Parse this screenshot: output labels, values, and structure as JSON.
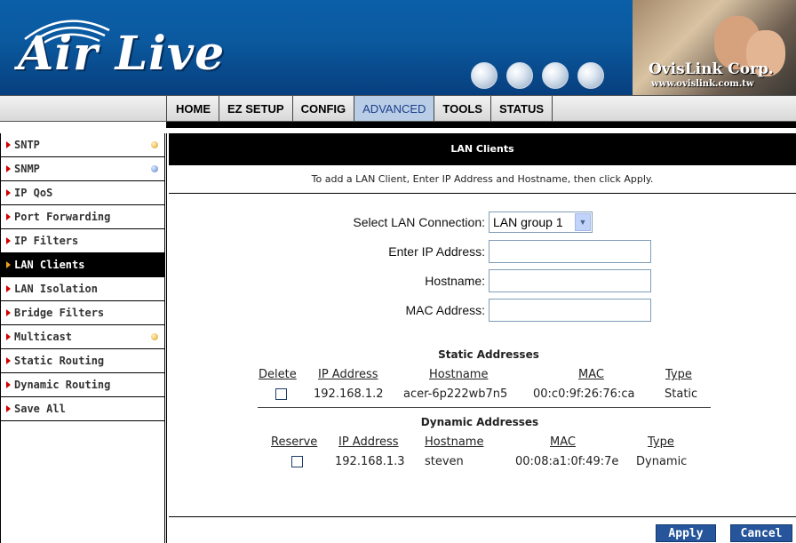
{
  "header": {
    "logo_text": "Air Live",
    "corp_name": "OvisLink Corp.",
    "corp_url": "www.ovislink.com.tw"
  },
  "nav": {
    "tabs": [
      {
        "label": "HOME",
        "active": false
      },
      {
        "label": "EZ SETUP",
        "active": false
      },
      {
        "label": "CONFIG",
        "active": false
      },
      {
        "label": "ADVANCED",
        "active": true
      },
      {
        "label": "TOOLS",
        "active": false
      },
      {
        "label": "STATUS",
        "active": false
      }
    ]
  },
  "sidebar": {
    "items": [
      {
        "label": "SNTP",
        "dot": "orange"
      },
      {
        "label": "SNMP",
        "dot": "blue"
      },
      {
        "label": "IP QoS"
      },
      {
        "label": "Port Forwarding"
      },
      {
        "label": "IP Filters"
      },
      {
        "label": "LAN Clients",
        "active": true
      },
      {
        "label": "LAN Isolation"
      },
      {
        "label": "Bridge Filters"
      },
      {
        "label": "Multicast",
        "dot": "orange"
      },
      {
        "label": "Static Routing"
      },
      {
        "label": "Dynamic Routing"
      },
      {
        "label": "Save All"
      }
    ]
  },
  "main": {
    "title": "LAN Clients",
    "instruction": "To add a LAN Client, Enter IP Address and Hostname, then click Apply.",
    "select_label": "Select LAN Connection:",
    "select_value": "LAN group 1",
    "ip_label": "Enter IP Address:",
    "ip_value": "",
    "hostname_label": "Hostname:",
    "hostname_value": "",
    "mac_label": "MAC Address:",
    "mac_value": "",
    "static": {
      "title": "Static Addresses",
      "columns": [
        "Delete",
        "IP Address",
        "Hostname",
        "MAC",
        "Type"
      ],
      "rows": [
        {
          "ip": "192.168.1.2",
          "hostname": "acer-6p222wb7n5",
          "mac": "00:c0:9f:26:76:ca",
          "type": "Static"
        }
      ]
    },
    "dynamic": {
      "title": "Dynamic Addresses",
      "columns": [
        "Reserve",
        "IP Address",
        "Hostname",
        "MAC",
        "Type"
      ],
      "rows": [
        {
          "ip": "192.168.1.3",
          "hostname": "steven",
          "mac": "00:08:a1:0f:49:7e",
          "type": "Dynamic"
        }
      ]
    },
    "apply_label": "Apply",
    "cancel_label": "Cancel"
  }
}
